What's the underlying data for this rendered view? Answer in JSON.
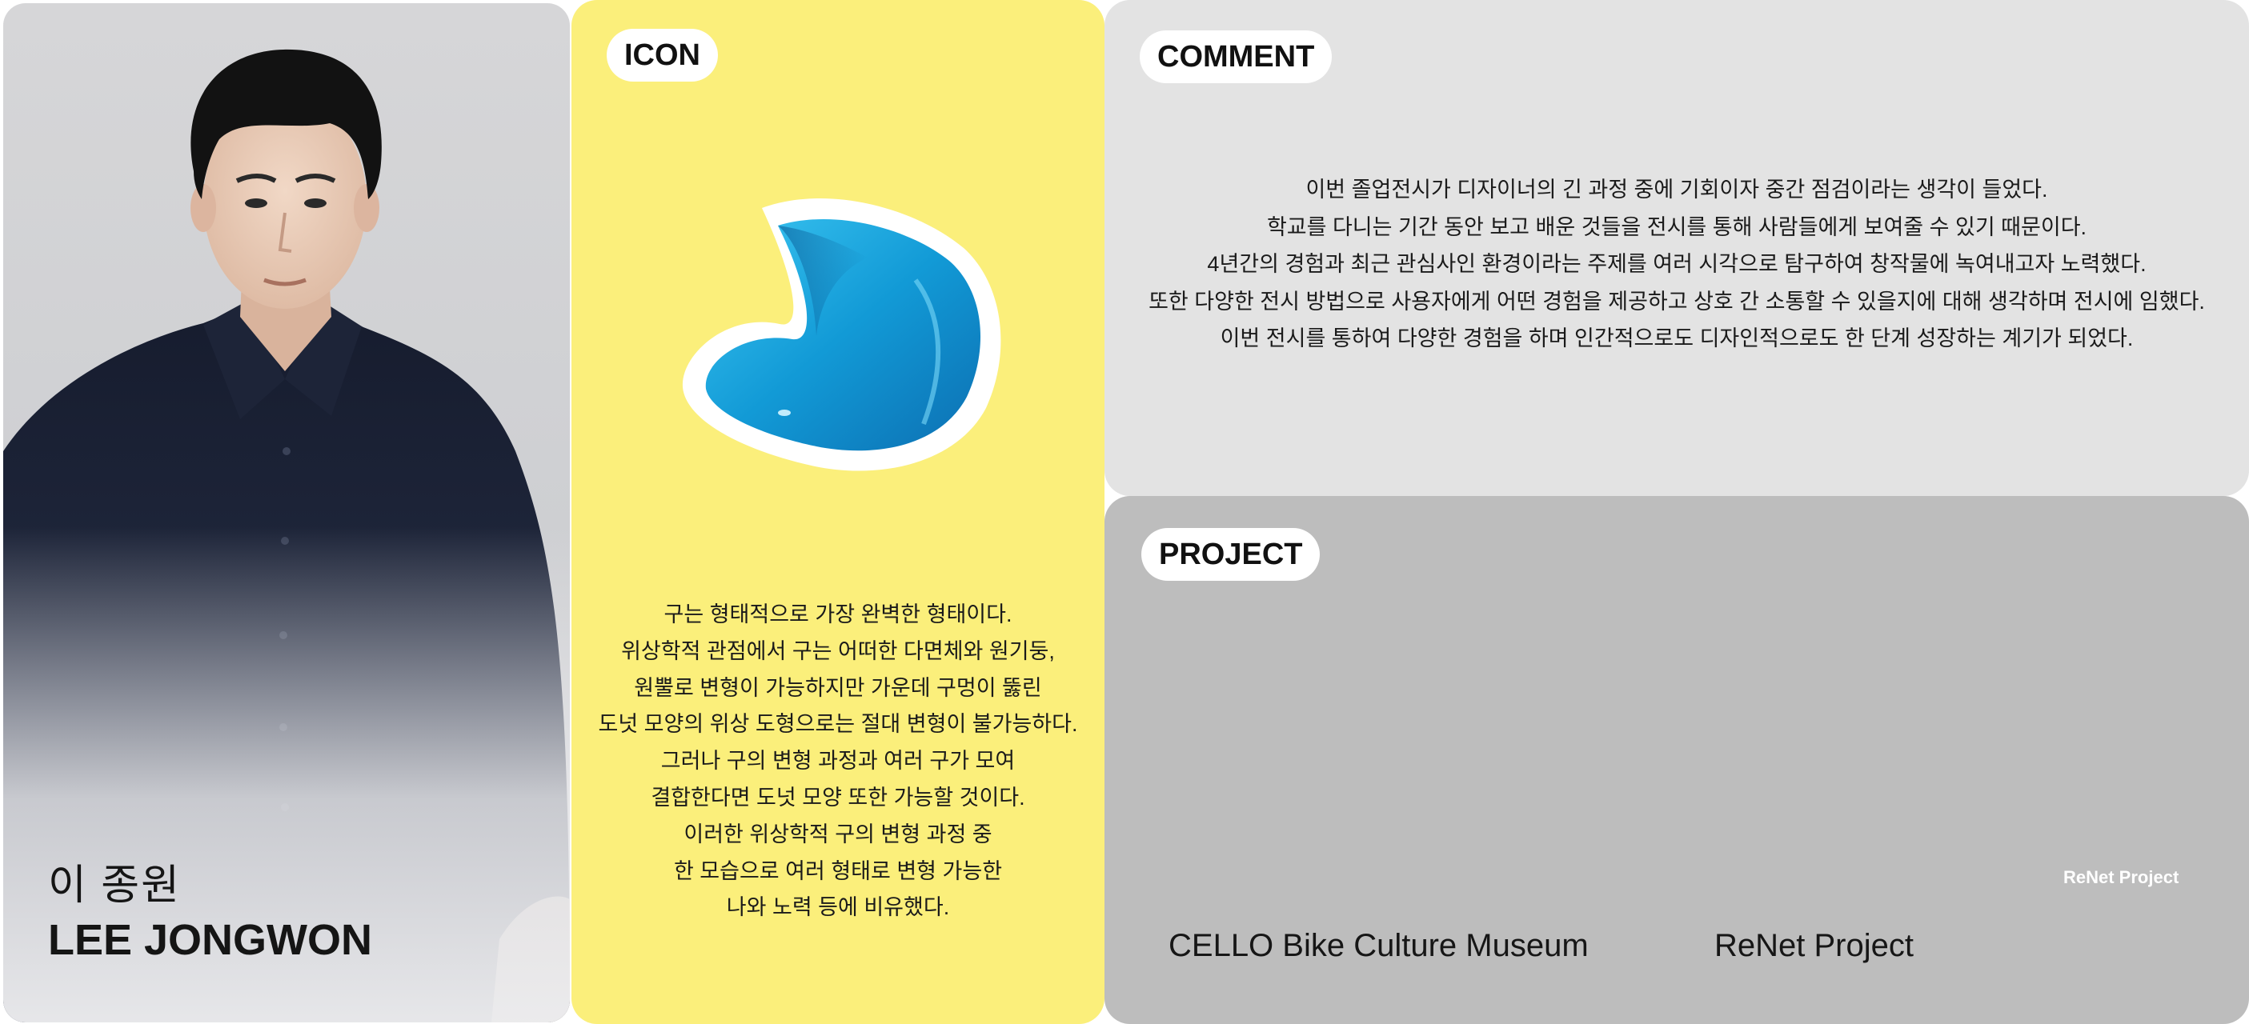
{
  "profile": {
    "name_ko": "이 종원",
    "name_en": "LEE JONGWON"
  },
  "icon_section": {
    "label": "ICON",
    "description": [
      "구는 형태적으로 가장 완벽한 형태이다.",
      "위상학적 관점에서 구는 어떠한 다면체와 원기둥,",
      "원뿔로 변형이 가능하지만 가운데 구멍이 뚫린",
      "도넛 모양의 위상 도형으로는 절대 변형이 불가능하다.",
      "그러나 구의 변형 과정과 여러 구가 모여",
      "결합한다면 도넛 모양 또한 가능할 것이다.",
      "이러한 위상학적 구의 변형 과정 중",
      "한 모습으로 여러 형태로 변형 가능한",
      "나와 노력 등에 비유했다."
    ]
  },
  "comment_section": {
    "label": "COMMENT",
    "lines": [
      "이번 졸업전시가 디자이너의 긴 과정 중에 기회이자 중간 점검이라는 생각이 들었다.",
      "학교를 다니는 기간 동안 보고 배운 것들을 전시를 통해 사람들에게 보여줄 수 있기 때문이다.",
      "4년간의 경험과 최근 관심사인 환경이라는 주제를 여러 시각으로 탐구하여 창작물에 녹여내고자 노력했다.",
      "또한 다양한 전시 방법으로 사용자에게 어떤 경험을 제공하고 상호 간 소통할 수 있을지에 대해 생각하며 전시에 임했다.",
      "이번 전시를 통하여 다양한 경험을 하며 인간적으로도 디자인적으로도 한 단계 성장하는 계기가 되었다."
    ]
  },
  "project_section": {
    "label": "PROJECT",
    "hover_tag": "ReNet Project",
    "items": [
      {
        "title": "CELLO Bike Culture Museum"
      },
      {
        "title": "ReNet Project"
      }
    ]
  },
  "colors": {
    "icon_panel_bg": "#fbef7b",
    "comment_panel_bg": "#e3e3e3",
    "project_panel_bg": "#bdbdbd",
    "profile_panel_bg": "#d2d3d6",
    "blob_blue": "#1a9fd6",
    "shirt_navy": "#1b2236"
  },
  "icons": {
    "icon_art": "blue-twisted-sphere-icon"
  }
}
